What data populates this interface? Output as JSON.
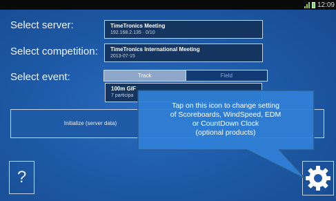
{
  "status_bar": {
    "time": "12:09"
  },
  "labels": {
    "select_server": "Select server:",
    "select_competition": "Select competition:",
    "select_event": "Select event:"
  },
  "server": {
    "name": "TimeTronics Meeting",
    "detail": "192.168.2.135 · 0/10"
  },
  "competition": {
    "name": "TimeTronics International Meeting",
    "date": "2013-07-15"
  },
  "event_tabs": [
    {
      "label": "Track",
      "selected": true
    },
    {
      "label": "Field",
      "selected": false
    }
  ],
  "event": {
    "name": "100m GIF",
    "detail": "7 participa"
  },
  "init_button": {
    "label": "Initialize (server data)"
  },
  "help_button": {
    "label": "?"
  },
  "gear_button": {
    "icon": "gear-icon"
  },
  "callout": {
    "line1": "Tap on this icon to change setting",
    "line2": "of Scoreboards, WindSpeed, EDM",
    "line3": "or CountDown Clock",
    "line4": "(optional products)"
  },
  "colors": {
    "background": "#1e5aa8",
    "field": "#13355f",
    "callout": "#2f7fd6",
    "callout_border": "#2b5d8c",
    "tab_active": "#8ea6c8"
  }
}
